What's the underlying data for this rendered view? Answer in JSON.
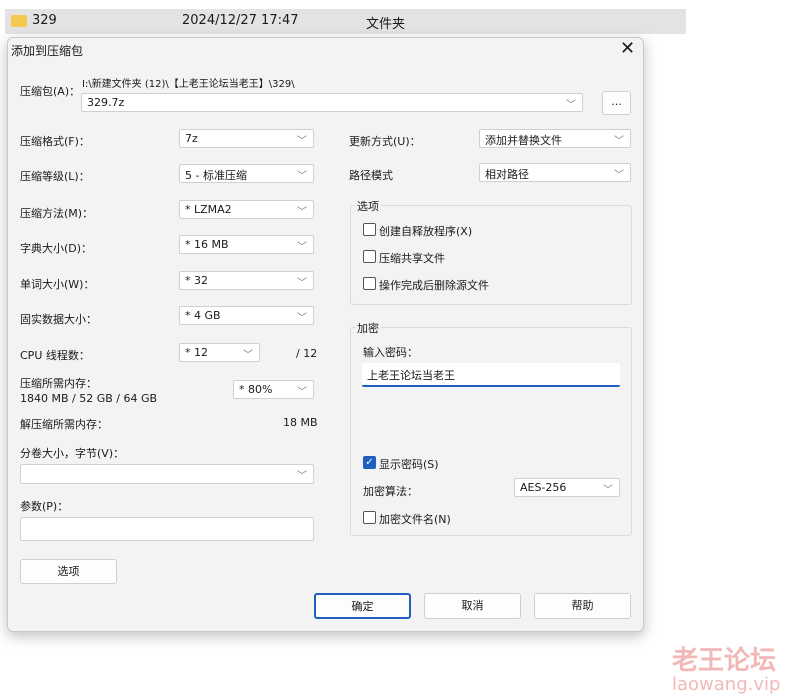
{
  "file_row": {
    "name": "329",
    "date": "2024/12/27 17:47",
    "type": "文件夹"
  },
  "dialog": {
    "title": "添加到压缩包",
    "archive_label": "压缩包(A)：",
    "archive_path": "I:\\新建文件夹 (12)\\【上老王论坛当老王】\\329\\",
    "archive_name": "329.7z",
    "browse": "...",
    "format_label": "压缩格式(F)：",
    "format": "7z",
    "level_label": "压缩等级(L)：",
    "level": "5 - 标准压缩",
    "method_label": "压缩方法(M)：",
    "method": "*  LZMA2",
    "dict_label": "字典大小(D)：",
    "dict": "*  16 MB",
    "word_label": "单词大小(W)：",
    "word": "*  32",
    "solid_label": "固实数据大小：",
    "solid": "*  4 GB",
    "cpu_label": "CPU 线程数：",
    "cpu": "*  12",
    "cpu_max": "/ 12",
    "mem_label": "压缩所需内存：",
    "mem_value": "1840 MB / 52 GB / 64 GB",
    "mem_pct": "*  80%",
    "decomp_label": "解压缩所需内存：",
    "decomp_value": "18 MB",
    "volume_label": "分卷大小，字节(V)：",
    "volume": "",
    "params_label": "参数(P)：",
    "params": "",
    "options_button": "选项",
    "update_label": "更新方式(U)：",
    "update": "添加并替换文件",
    "path_label": "路径模式",
    "path": "相对路径",
    "options_group": "选项",
    "opt_sfx": "创建自释放程序(X)",
    "opt_shared": "压缩共享文件",
    "opt_delete": "操作完成后删除源文件",
    "enc_group": "加密",
    "pwd_label": "输入密码：",
    "pwd": "上老王论坛当老王",
    "show_pwd": "显示密码(S)",
    "enc_method_label": "加密算法：",
    "enc_method": "AES-256",
    "enc_names": "加密文件名(N)",
    "ok": "确定",
    "cancel": "取消",
    "help": "帮助"
  },
  "watermark": {
    "cn": "老王论坛",
    "url": "laowang.vip"
  }
}
